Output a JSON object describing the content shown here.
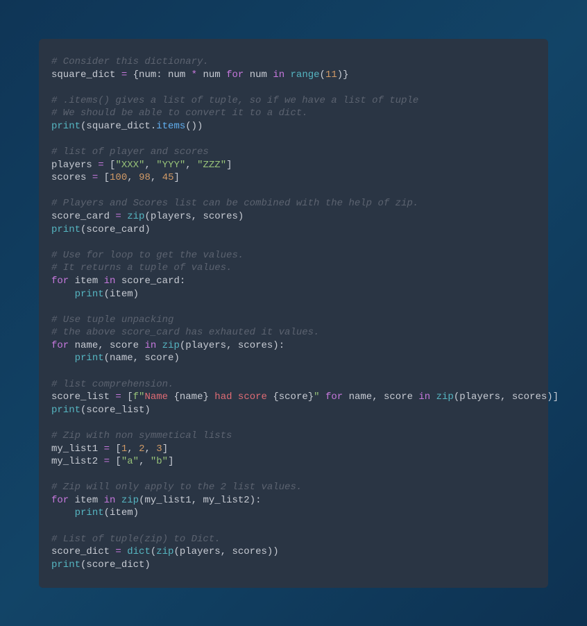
{
  "code": {
    "l1": "# Consider this dictionary.",
    "l2a": "square_dict ",
    "l2b": "=",
    "l2c": " {num: num ",
    "l2d": "*",
    "l2e": " num ",
    "l2f": "for",
    "l2g": " num ",
    "l2h": "in",
    "l2i": " ",
    "l2j": "range",
    "l2k": "(",
    "l2l": "11",
    "l2m": ")}",
    "l3": "",
    "l4": "# .items() gives a list of tuple, so if we have a list of tuple",
    "l5": "# We should be able to convert it to a dict.",
    "l6a": "print",
    "l6b": "(square_dict.",
    "l6c": "items",
    "l6d": "())",
    "l7": "",
    "l8": "# list of player and scores",
    "l9a": "players ",
    "l9b": "=",
    "l9c": " [",
    "l9d": "\"XXX\"",
    "l9e": ", ",
    "l9f": "\"YYY\"",
    "l9g": ", ",
    "l9h": "\"ZZZ\"",
    "l9i": "]",
    "l10a": "scores ",
    "l10b": "=",
    "l10c": " [",
    "l10d": "100",
    "l10e": ", ",
    "l10f": "98",
    "l10g": ", ",
    "l10h": "45",
    "l10i": "]",
    "l11": "",
    "l12": "# Players and Scores list can be combined with the help of zip.",
    "l13a": "score_card ",
    "l13b": "=",
    "l13c": " ",
    "l13d": "zip",
    "l13e": "(players, scores)",
    "l14a": "print",
    "l14b": "(score_card)",
    "l15": "",
    "l16": "# Use for loop to get the values.",
    "l17": "# It returns a tuple of values.",
    "l18a": "for",
    "l18b": " item ",
    "l18c": "in",
    "l18d": " score_card:",
    "l19a": "    ",
    "l19b": "print",
    "l19c": "(item)",
    "l20": "",
    "l21": "# Use tuple unpacking",
    "l22": "# the above score_card has exhauted it values.",
    "l23a": "for",
    "l23b": " name, score ",
    "l23c": "in",
    "l23d": " ",
    "l23e": "zip",
    "l23f": "(players, scores):",
    "l24a": "    ",
    "l24b": "print",
    "l24c": "(name, score)",
    "l25": "",
    "l26": "# list comprehension.",
    "l27a": "score_list ",
    "l27b": "=",
    "l27c": " [",
    "l27d": "f\"",
    "l27e": "Name ",
    "l27f": "{name}",
    "l27g": " ",
    "l27h": "had",
    "l27i": " ",
    "l27j": "score",
    "l27k": " ",
    "l27l": "{score}",
    "l27m": "\"",
    "l27n": " ",
    "l27o": "for",
    "l27p": " name, score ",
    "l27q": "in",
    "l27r": " ",
    "l27s": "zip",
    "l27t": "(players, scores)]",
    "l28a": "print",
    "l28b": "(score_list)",
    "l29": "",
    "l30": "# Zip with non symmetical lists",
    "l31a": "my_list1 ",
    "l31b": "=",
    "l31c": " [",
    "l31d": "1",
    "l31e": ", ",
    "l31f": "2",
    "l31g": ", ",
    "l31h": "3",
    "l31i": "]",
    "l32a": "my_list2 ",
    "l32b": "=",
    "l32c": " [",
    "l32d": "\"a\"",
    "l32e": ", ",
    "l32f": "\"b\"",
    "l32g": "]",
    "l33": "",
    "l34": "# Zip will only apply to the 2 list values.",
    "l35a": "for",
    "l35b": " item ",
    "l35c": "in",
    "l35d": " ",
    "l35e": "zip",
    "l35f": "(my_list1, my_list2):",
    "l36a": "    ",
    "l36b": "print",
    "l36c": "(item)",
    "l37": "",
    "l38": "# List of tuple(zip) to Dict.",
    "l39a": "score_dict ",
    "l39b": "=",
    "l39c": " ",
    "l39d": "dict",
    "l39e": "(",
    "l39f": "zip",
    "l39g": "(players, scores))",
    "l40a": "print",
    "l40b": "(score_dict)"
  }
}
